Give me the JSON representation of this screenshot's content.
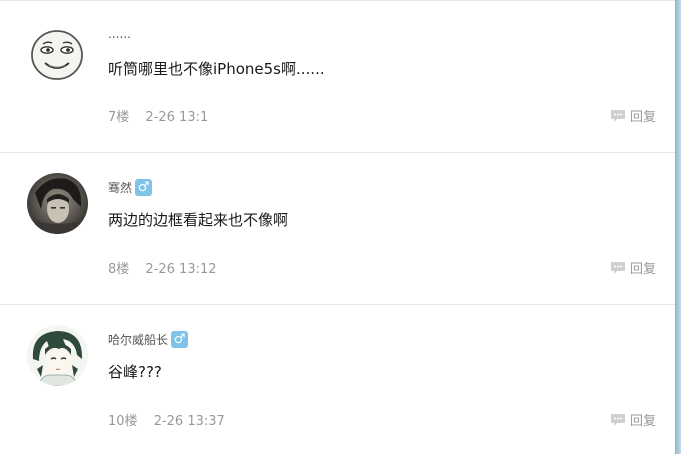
{
  "posts": [
    {
      "username": "......",
      "has_gender_badge": false,
      "content": "听筒哪里也不像iPhone5s啊......",
      "floor": "7楼",
      "time": "2-26 13:1",
      "avatar_icon": "meme-face-avatar"
    },
    {
      "username": "骞然",
      "has_gender_badge": true,
      "gender_symbol": "♂",
      "content": "两边的边框看起来也不像啊",
      "floor": "8楼",
      "time": "2-26 13:12",
      "avatar_icon": "dark-anime-avatar"
    },
    {
      "username": "哈尔威船长",
      "has_gender_badge": true,
      "gender_symbol": "♂",
      "content": "谷峰???",
      "floor": "10楼",
      "time": "2-26 13:37",
      "avatar_icon": "green-hair-anime-avatar"
    }
  ],
  "reply_label": "回复",
  "colors": {
    "gender_badge": "#7fc4e8",
    "meta_text": "#999999",
    "divider": "#e6e6e6",
    "right_edge": "#9ec3d4"
  }
}
